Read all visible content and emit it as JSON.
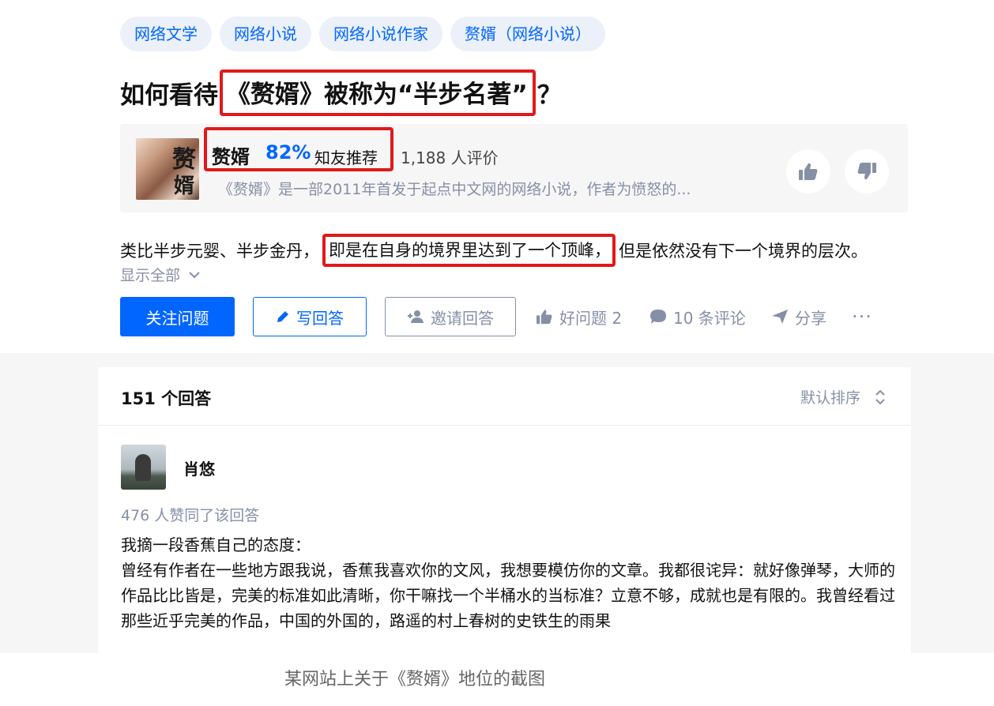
{
  "topics": [
    "网络文学",
    "网络小说",
    "网络小说作家",
    "赘婿（网络小说）"
  ],
  "question": {
    "prefix": "如何看待",
    "highlight": "《赘婿》被称为“半步名著”",
    "suffix": "？"
  },
  "book": {
    "name": "赘婿",
    "percent": "82%",
    "recommend_label": "知友推荐",
    "rating_count": "1,188 人评价",
    "description": "《赘婿》是一部2011年首发于起点中文网的网络小说，作者为愤怒的...",
    "cover_chars": [
      "赘",
      "婿"
    ]
  },
  "excerpt": {
    "before": "类比半步元婴、半步金丹，",
    "highlight": "即是在自身的境界里达到了一个顶峰，",
    "after": "但是依然没有下一个境界的层次。"
  },
  "show_all": "显示全部",
  "actions": {
    "follow": "关注问题",
    "write": "写回答",
    "invite": "邀请回答",
    "good": "好问题 2",
    "comments": "10 条评论",
    "share": "分享",
    "more": "···"
  },
  "answers": {
    "count": "151 个回答",
    "sort": "默认排序"
  },
  "answer": {
    "author": "肖悠",
    "votes": "476 人赞同了该回答",
    "paragraphs": [
      "我摘一段香蕉自己的态度：",
      "曾经有作者在一些地方跟我说，香蕉我喜欢你的文风，我想要模仿你的文章。我都很诧异：就好像弹琴，大师的作品比比皆是，完美的标准如此清晰，你干嘛找一个半桶水的当标准？立意不够，成就也是有限的。我曾经看过那些近乎完美的作品，中国的外国的，路遥的村上春树的史铁生的雨果"
    ]
  },
  "caption": "某网站上关于《赘婿》地位的截图",
  "colors": {
    "accent": "#0066ff",
    "highlight_border": "#e0191a",
    "muted": "#8590a6",
    "tag_bg": "#ebf0f9"
  }
}
